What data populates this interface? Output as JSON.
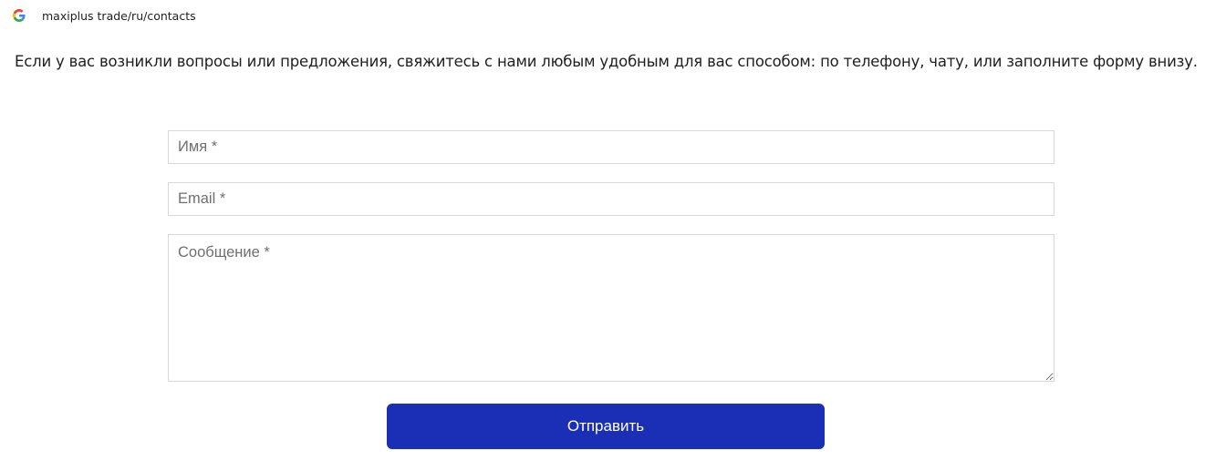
{
  "address_bar": {
    "url": "maxiplus trade/ru/contacts",
    "icon": "google-g-icon",
    "icon_colors": [
      "#4285F4",
      "#EA4335",
      "#FBBC05",
      "#34A853"
    ]
  },
  "intro_text": "Если у вас возникли вопросы или предложения, свяжитесь с нами любым удобным для вас способом: по телефону, чату, или заполните форму внизу.",
  "form": {
    "name": {
      "value": "",
      "placeholder": "Имя *"
    },
    "email": {
      "value": "",
      "placeholder": "Email *"
    },
    "message": {
      "value": "",
      "placeholder": "Сообщение *"
    },
    "submit_label": "Отправить"
  },
  "colors": {
    "accent": "#1A2FB5",
    "field_border": "#D7D7D7",
    "placeholder": "#6F6F6F"
  }
}
